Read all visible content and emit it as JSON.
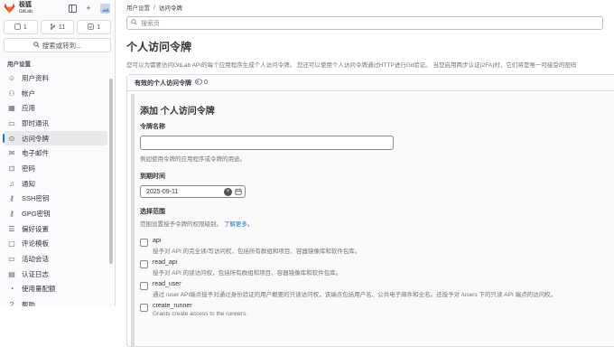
{
  "sidebar": {
    "brand": "极狐",
    "brand_sub": "GitLab",
    "counters": [
      {
        "icon": "merge-request-icon",
        "count": "1"
      },
      {
        "icon": "branch-icon",
        "count": "11"
      },
      {
        "icon": "todo-icon",
        "count": "1"
      }
    ],
    "search_label": "搜索或转到...",
    "section": "用户设置",
    "items": [
      {
        "label": "用户资料",
        "icon": "user-icon"
      },
      {
        "label": "帐户",
        "icon": "account-icon"
      },
      {
        "label": "应用",
        "icon": "applications-icon"
      },
      {
        "label": "即时通讯",
        "icon": "chat-icon"
      },
      {
        "label": "访问令牌",
        "icon": "token-icon"
      },
      {
        "label": "电子邮件",
        "icon": "mail-icon"
      },
      {
        "label": "密码",
        "icon": "lock-icon"
      },
      {
        "label": "通知",
        "icon": "notification-icon"
      },
      {
        "label": "SSH密钥",
        "icon": "key-icon"
      },
      {
        "label": "GPG密钥",
        "icon": "key-icon"
      },
      {
        "label": "偏好设置",
        "icon": "preferences-icon"
      },
      {
        "label": "评论模板",
        "icon": "comment-icon"
      },
      {
        "label": "活动会话",
        "icon": "monitor-icon"
      },
      {
        "label": "认证日志",
        "icon": "log-icon"
      },
      {
        "label": "使用量配额",
        "icon": "quota-icon"
      },
      {
        "label": "帮助",
        "icon": "help-icon"
      }
    ]
  },
  "breadcrumb": {
    "parent": "用户设置",
    "separator": "/",
    "current": "访问令牌"
  },
  "search_placeholder": "搜索页",
  "page_title": "个人访问令牌",
  "page_desc": "您可以为需要访问GitLab API的每个应用程序生成个人访问令牌。 您还可以使用个人访问令牌通过HTTP进行Git验证。 当您启用两步认证(2FA)时，它们将是唯一可接受的密码",
  "card": {
    "title": "有效的个人访问令牌",
    "count": "0"
  },
  "form": {
    "title": "添加 个人访问令牌",
    "name_label": "令牌名称",
    "name_value": "",
    "name_help": "例如使用令牌的应用程序或令牌的用途。",
    "expiry_label": "到期时间",
    "expiry_value": "2025-09-11",
    "scopes_label": "选择范围",
    "scopes_help": "范围设置授予令牌的权限级别。",
    "scopes_link": "了解更多。",
    "scopes": [
      {
        "name": "api",
        "desc": "授予对 API 的完全读/写访问权，包括所有群组和项目、容器镜像库和软件包库。"
      },
      {
        "name": "read_api",
        "desc": "授予对 API 的读访问权，包括所有群组和项目、容器镜像库和软件包库。"
      },
      {
        "name": "read_user",
        "desc": "通过 /user API端点授予对通过身份验证的用户概要的只读访问权，该端点包括用户名、公共电子邮件和全名。还授予对 /users 下的只读 API 端点的访问权。"
      },
      {
        "name": "create_runner",
        "desc": "Grants create access to the runners."
      }
    ]
  }
}
